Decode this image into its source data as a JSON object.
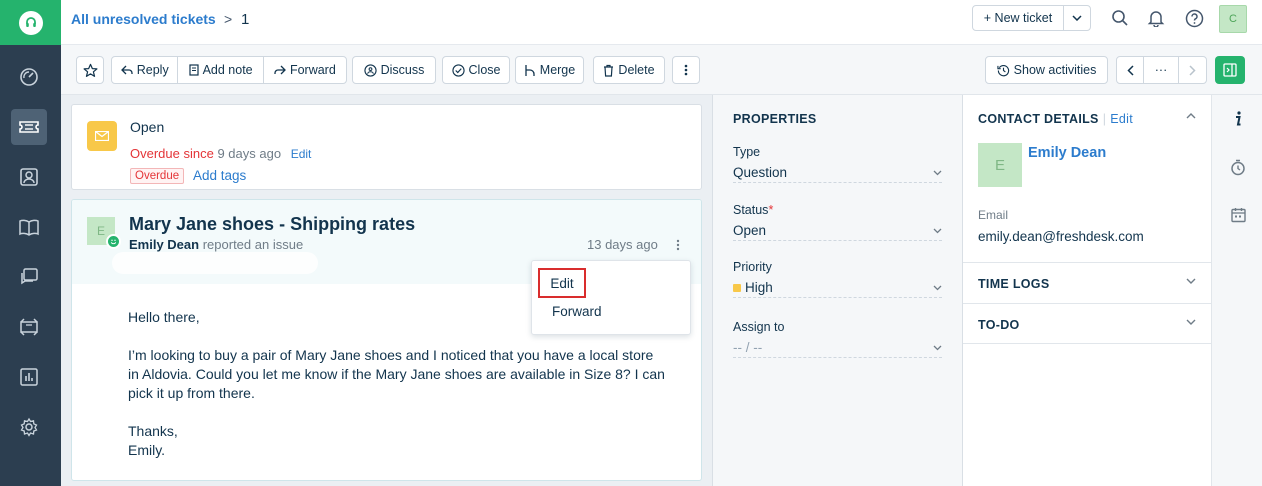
{
  "header": {
    "breadcrumb_link": "All unresolved tickets",
    "breadcrumb_sep": ">",
    "ticket_id": "1",
    "new_ticket_label": "+ New ticket",
    "user_initial": "C"
  },
  "nav": {
    "items": [
      "dashboard-icon",
      "tickets-icon",
      "contacts-icon",
      "solutions-icon",
      "forums-icon",
      "groups-icon",
      "reports-icon",
      "admin-icon"
    ],
    "active": "tickets-icon"
  },
  "toolbar": {
    "reply": "Reply",
    "add_note": "Add note",
    "forward": "Forward",
    "discuss": "Discuss",
    "close": "Close",
    "merge": "Merge",
    "delete": "Delete",
    "show_activities": "Show activities",
    "more": "···"
  },
  "status_card": {
    "status": "Open",
    "overdue_prefix": "Overdue since",
    "overdue_since": "9 days ago",
    "edit": "Edit",
    "badge": "Overdue",
    "add_tags": "Add tags"
  },
  "conversation": {
    "avatar_initial": "E",
    "subject": "Mary Jane shoes - Shipping rates",
    "requester": "Emily Dean",
    "action": "reported an issue",
    "time": "13 days ago",
    "body": [
      "Hello there,",
      "I’m looking to buy a pair of Mary Jane shoes and I noticed that you have a local store in Aldovia. Could you let me know if the Mary Jane shoes are available in Size 8? I can pick it up from there.",
      "Thanks,",
      "Emily."
    ],
    "menu": {
      "edit": "Edit",
      "forward": "Forward"
    }
  },
  "properties": {
    "title": "PROPERTIES",
    "type_label": "Type",
    "type_value": "Question",
    "status_label": "Status",
    "status_required": "*",
    "status_value": "Open",
    "priority_label": "Priority",
    "priority_value": "High",
    "priority_color": "#f8c849",
    "assign_label": "Assign to",
    "assign_value": "-- / --"
  },
  "contact": {
    "title": "CONTACT DETAILS",
    "sep": "|",
    "edit": "Edit",
    "avatar_initial": "E",
    "name": "Emily Dean",
    "email_label": "Email",
    "email": "emily.dean@freshdesk.com",
    "time_logs": "TIME LOGS",
    "todo": "TO-DO"
  },
  "colors": {
    "brand_green": "#25b36d",
    "nav_bg": "#2c3e50",
    "link_blue": "#2c7ccd",
    "overdue_red": "#e43538",
    "highlight_red": "#d92d2d"
  }
}
